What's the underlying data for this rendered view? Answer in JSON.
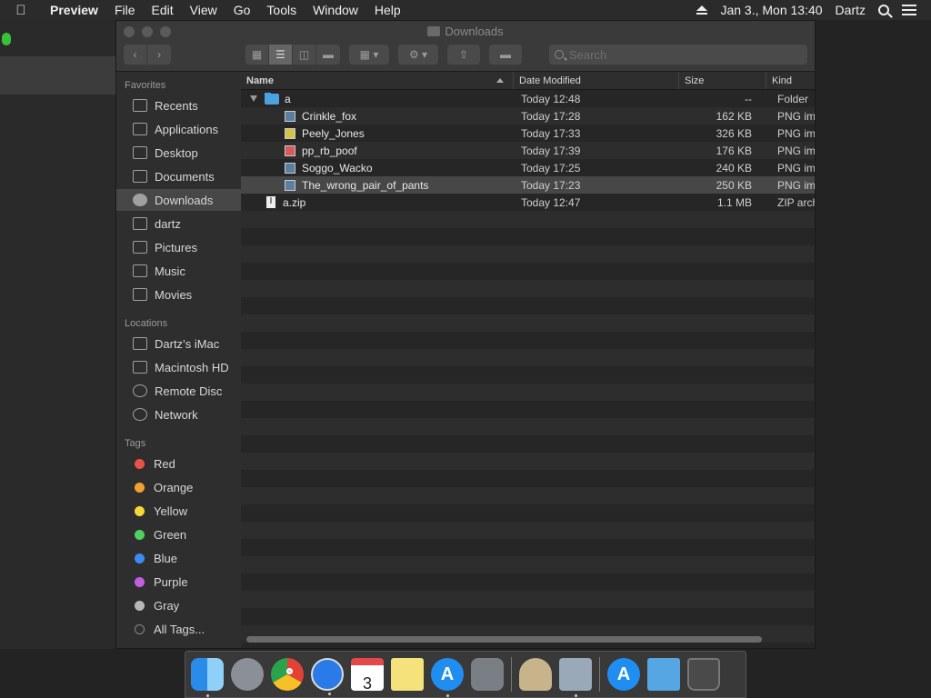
{
  "menubar": {
    "app_name": "Preview",
    "menus": [
      "File",
      "Edit",
      "View",
      "Go",
      "Tools",
      "Window",
      "Help"
    ],
    "datetime": "Jan 3., Mon  13:40",
    "user": "Dartz"
  },
  "window": {
    "title": "Downloads",
    "search_placeholder": "Search"
  },
  "sidebar": {
    "favorites_header": "Favorites",
    "favorites": [
      "Recents",
      "Applications",
      "Desktop",
      "Documents",
      "Downloads",
      "dartz",
      "Pictures",
      "Music",
      "Movies"
    ],
    "selected": "Downloads",
    "locations_header": "Locations",
    "locations": [
      "Dartz’s iMac",
      "Macintosh HD",
      "Remote Disc",
      "Network"
    ],
    "tags_header": "Tags",
    "tags": [
      {
        "label": "Red",
        "color": "#e8524a"
      },
      {
        "label": "Orange",
        "color": "#f0a030"
      },
      {
        "label": "Yellow",
        "color": "#f4d83a"
      },
      {
        "label": "Green",
        "color": "#50d060"
      },
      {
        "label": "Blue",
        "color": "#3a8cf0"
      },
      {
        "label": "Purple",
        "color": "#c060e0"
      },
      {
        "label": "Gray",
        "color": "#b8b8b8"
      }
    ],
    "all_tags": "All Tags..."
  },
  "columns": {
    "name": "Name",
    "date": "Date Modified",
    "size": "Size",
    "kind": "Kind"
  },
  "files": [
    {
      "name": "a",
      "date": "Today 12:48",
      "size": "--",
      "kind": "Folder"
    },
    {
      "name": "Crinkle_fox",
      "date": "Today 17:28",
      "size": "162 KB",
      "kind": "PNG ima"
    },
    {
      "name": "Peely_Jones",
      "date": "Today 17:33",
      "size": "326 KB",
      "kind": "PNG ima"
    },
    {
      "name": "pp_rb_poof",
      "date": "Today 17:39",
      "size": "176 KB",
      "kind": "PNG ima"
    },
    {
      "name": "Soggo_Wacko",
      "date": "Today 17:25",
      "size": "240 KB",
      "kind": "PNG ima"
    },
    {
      "name": "The_wrong_pair_of_pants",
      "date": "Today 17:23",
      "size": "250 KB",
      "kind": "PNG ima"
    },
    {
      "name": "a.zip",
      "date": "Today 12:47",
      "size": "1.1 MB",
      "kind": "ZIP arch"
    }
  ],
  "dock": {
    "calendar_day": "3",
    "appstore_glyph": "A"
  }
}
